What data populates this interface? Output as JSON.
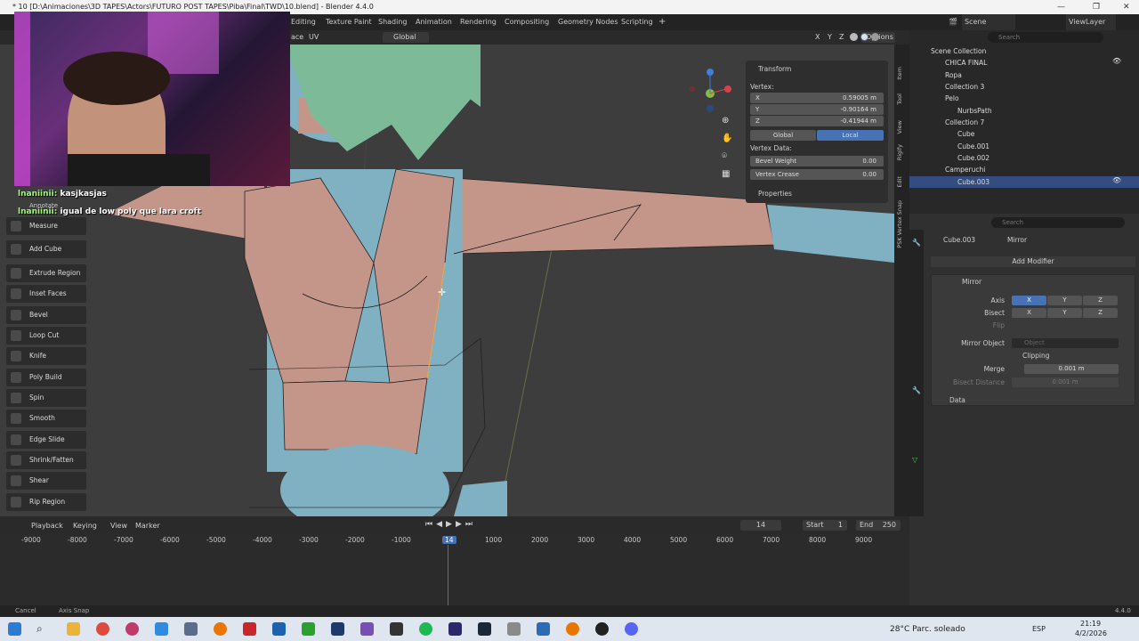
{
  "window": {
    "title": "* 10 [D:\\Animaciones\\3D TAPES\\Actors\\FUTURO POST TAPES\\Piba\\Final\\TWD\\10.blend] - Blender 4.4.0"
  },
  "workspace_tabs": [
    "Editing",
    "Texture Paint",
    "Shading",
    "Animation",
    "Rendering",
    "Compositing",
    "Geometry Nodes",
    "Scripting"
  ],
  "topbar_right": {
    "scene": "Scene",
    "view_layer": "ViewLayer"
  },
  "viewport_header": {
    "menu_face": "ace",
    "menu_uv": "UV",
    "orientation": "Global",
    "options": "Options",
    "axes": [
      "X",
      "Y",
      "Z"
    ]
  },
  "chat": [
    {
      "user": "lnaniinii:",
      "text": "kasjkasjas"
    },
    {
      "user": "lnaniinii:",
      "text": "igual de low poly que lara croft"
    }
  ],
  "toolbar": [
    "Annotate",
    "Measure",
    "Add Cube",
    "Extrude Region",
    "Inset Faces",
    "Bevel",
    "Loop Cut",
    "Knife",
    "Poly Build",
    "Spin",
    "Smooth",
    "Edge Slide",
    "Shrink/Fatten",
    "Shear",
    "Rip Region"
  ],
  "npanel": {
    "section": "Transform",
    "vertex_label": "Vertex:",
    "x": {
      "label": "X",
      "value": "0.59005 m"
    },
    "y": {
      "label": "Y",
      "value": "-0.90164 m"
    },
    "z": {
      "label": "Z",
      "value": "-0.41944 m"
    },
    "global": "Global",
    "local": "Local",
    "vertex_data": "Vertex Data:",
    "bevel_weight": {
      "label": "Bevel Weight",
      "value": "0.00"
    },
    "vertex_crease": {
      "label": "Vertex Crease",
      "value": "0.00"
    },
    "properties": "Properties"
  },
  "side_tabs": [
    "Item",
    "Tool",
    "View",
    "Rigify",
    "Edit",
    "PSK Vertex Snap"
  ],
  "outliner": {
    "search_placeholder": "Search",
    "rows": [
      {
        "name": "Scene Collection",
        "indent": 0
      },
      {
        "name": "CHICA FINAL",
        "indent": 1
      },
      {
        "name": "Ropa",
        "indent": 1
      },
      {
        "name": "Collection 3",
        "indent": 1
      },
      {
        "name": "Pelo",
        "indent": 1
      },
      {
        "name": "NurbsPath",
        "indent": 2
      },
      {
        "name": "Collection 7",
        "indent": 1
      },
      {
        "name": "Cube",
        "indent": 2
      },
      {
        "name": "Cube.001",
        "indent": 2
      },
      {
        "name": "Cube.002",
        "indent": 2
      },
      {
        "name": "Camperuchi",
        "indent": 1
      },
      {
        "name": "Cube.003",
        "indent": 2
      }
    ]
  },
  "properties": {
    "search_placeholder": "Search",
    "object": "Cube.003",
    "modifier_crumb": "Mirror",
    "add_modifier": "Add Modifier",
    "modifier_name": "Mirror",
    "axis_label": "Axis",
    "bisect_label": "Bisect",
    "flip_label": "Flip",
    "xyz": [
      "X",
      "Y",
      "Z"
    ],
    "mirror_object_label": "Mirror Object",
    "mirror_object_placeholder": "Object",
    "clipping": "Clipping",
    "merge_label": "Merge",
    "merge_value": "0.001 m",
    "bisect_distance_label": "Bisect Distance",
    "bisect_distance_value": "0.001 m",
    "data": "Data"
  },
  "timeline": {
    "menus": [
      "Playback",
      "Keying",
      "View",
      "Marker"
    ],
    "current_frame": "14",
    "start_label": "Start",
    "start": "1",
    "end_label": "End",
    "end": "250",
    "ticks": [
      "-9000",
      "-8000",
      "-7000",
      "-6000",
      "-5000",
      "-4000",
      "-3000",
      "-2000",
      "-1000",
      "14",
      "1000",
      "2000",
      "3000",
      "4000",
      "5000",
      "6000",
      "7000",
      "8000",
      "9000"
    ]
  },
  "statusbar": {
    "cancel": "Cancel",
    "axis_snap": "Axis Snap",
    "version": "4.4.0"
  },
  "taskbar": {
    "weather": "28°C  Parc. soleado",
    "lang": "ESP",
    "time": "21:19",
    "date": "4/2/2026"
  },
  "colors": {
    "accent_blue": "#4772b3",
    "mesh_skin": "#c4968a",
    "mesh_body": "#7fb1c3",
    "hair": "#7dbb98"
  }
}
